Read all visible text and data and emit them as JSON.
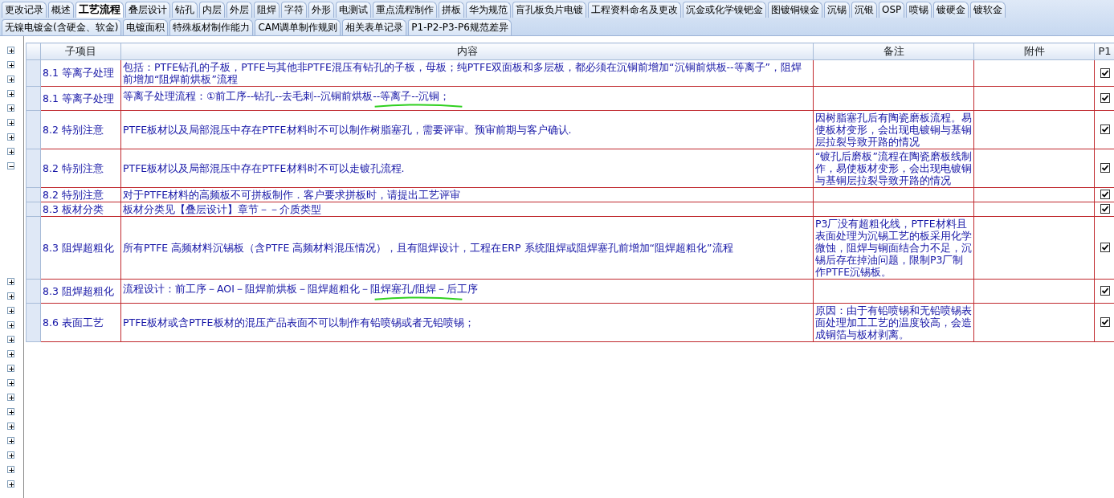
{
  "tabs_row_1": [
    {
      "label": "更改记录",
      "selected": false
    },
    {
      "label": "概述",
      "selected": false
    },
    {
      "label": "工艺流程",
      "selected": true
    },
    {
      "label": "叠层设计",
      "selected": false
    },
    {
      "label": "钻孔",
      "selected": false
    },
    {
      "label": "内层",
      "selected": false
    },
    {
      "label": "外层",
      "selected": false
    },
    {
      "label": "阻焊",
      "selected": false
    },
    {
      "label": "字符",
      "selected": false
    },
    {
      "label": "外形",
      "selected": false
    },
    {
      "label": "电测试",
      "selected": false
    },
    {
      "label": "重点流程制作",
      "selected": false
    },
    {
      "label": "拼板",
      "selected": false
    },
    {
      "label": "华为规范",
      "selected": false
    },
    {
      "label": "盲孔板负片电镀",
      "selected": false
    },
    {
      "label": "工程资料命名及更改",
      "selected": false
    },
    {
      "label": "沉金或化学镍钯金",
      "selected": false
    },
    {
      "label": "图镀铜镍金",
      "selected": false
    },
    {
      "label": "沉锡",
      "selected": false
    },
    {
      "label": "沉银",
      "selected": false
    },
    {
      "label": "OSP",
      "selected": false
    },
    {
      "label": "喷锡",
      "selected": false
    },
    {
      "label": "镀硬金",
      "selected": false
    },
    {
      "label": "镀软金",
      "selected": false
    }
  ],
  "tabs_row_2": [
    {
      "label": "无镍电镀金(含硬金、软金)",
      "selected": false
    },
    {
      "label": "电镀面积",
      "selected": false
    },
    {
      "label": "特殊板材制作能力",
      "selected": false
    },
    {
      "label": "CAM调单制作规则",
      "selected": false
    },
    {
      "label": "相关表单记录",
      "selected": false
    },
    {
      "label": "P1-P2-P3-P6规范差异",
      "selected": false
    }
  ],
  "tree": [
    {
      "expanded": false
    },
    {
      "expanded": false
    },
    {
      "expanded": false
    },
    {
      "expanded": false
    },
    {
      "expanded": false
    },
    {
      "expanded": false
    },
    {
      "expanded": false
    },
    {
      "expanded": false
    },
    {
      "expanded": true
    },
    {
      "expanded": false
    },
    {
      "expanded": false
    },
    {
      "expanded": false
    },
    {
      "expanded": false
    },
    {
      "expanded": false
    },
    {
      "expanded": false
    },
    {
      "expanded": false
    },
    {
      "expanded": false
    },
    {
      "expanded": false
    },
    {
      "expanded": false
    },
    {
      "expanded": false
    },
    {
      "expanded": false
    },
    {
      "expanded": false
    },
    {
      "expanded": false
    },
    {
      "expanded": false
    }
  ],
  "table": {
    "columns": [
      "子项目",
      "内容",
      "备注",
      "附件",
      "P1"
    ],
    "rows": [
      {
        "sub_item": "8.1 等离子处理",
        "content": "包括：PTFE钻孔的子板，PTFE与其他非PTFE混压有钻孔的子板，母板；纯PTFE双面板和多层板，都必须在沉铜前增加“沉铜前烘板--等离子”，阻焊前增加“阻焊前烘板”流程",
        "remark": "",
        "p1": true,
        "marked": false
      },
      {
        "sub_item": "8.1 等离子处理",
        "content": "等离子处理流程：①前工序--钻孔--去毛刺--沉铜前烘板--等离子--沉铜；",
        "remark": "",
        "p1": true,
        "marked": true
      },
      {
        "sub_item": "8.2 特别注意",
        "content": "PTFE板材以及局部混压中存在PTFE材料时不可以制作树脂塞孔，需要评审。预审前期与客户确认.",
        "remark": "因树脂塞孔后有陶瓷磨板流程。易使板材变形，会出现电镀铜与基铜层拉裂导致开路的情况",
        "p1": true,
        "marked": false
      },
      {
        "sub_item": "8.2 特别注意",
        "content": "PTFE板材以及局部混压中存在PTFE材料时不可以走镀孔流程.",
        "remark": "“镀孔后磨板”流程在陶瓷磨板线制作，易使板材变形，会出现电镀铜与基铜层拉裂导致开路的情况",
        "p1": true,
        "marked": false
      },
      {
        "sub_item": "8.2 特别注意",
        "content": "对于PTFE材料的高频板不可拼板制作．客户要求拼板时，请提出工艺评审",
        "remark": "",
        "p1": true,
        "marked": false
      },
      {
        "sub_item": "8.3 板材分类",
        "content": "板材分类见【叠层设计】章节－－介质类型",
        "remark": "",
        "p1": true,
        "marked": false
      },
      {
        "sub_item": "8.3 阻焊超粗化",
        "content": "所有PTFE 高频材料沉锡板（含PTFE 高频材料混压情况），且有阻焊设计，工程在ERP 系统阻焊或阻焊塞孔前增加“阻焊超粗化”流程",
        "remark": "P3厂没有超粗化线，PTFE材料且表面处理为沉锡工艺的板采用化学微蚀，阻焊与铜面结合力不足，沉锡后存在掉油问题，限制P3厂制作PTFE沉锡板。",
        "p1": true,
        "marked": false
      },
      {
        "sub_item": "8.3 阻焊超粗化",
        "content": "流程设计：前工序－AOI－阻焊前烘板－阻焊超粗化－阻焊塞孔/阻焊－后工序",
        "remark": "",
        "p1": true,
        "marked": true
      },
      {
        "sub_item": "8.6 表面工艺",
        "content": "PTFE板材或含PTFE板材的混压产品表面不可以制作有铅喷锡或者无铅喷锡；",
        "remark": "原因：由于有铅喷锡和无铅喷锡表面处理加工工艺的温度较高，会造成铜箔与板材剥离。",
        "p1": true,
        "marked": false
      }
    ]
  }
}
